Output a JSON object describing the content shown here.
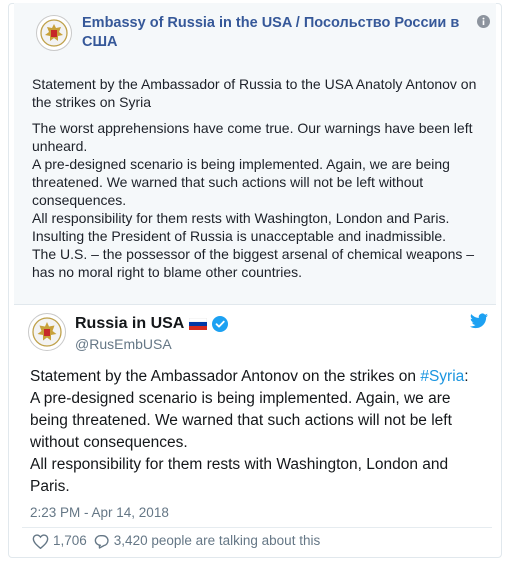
{
  "facebook_post": {
    "page_name": "Embassy of Russia in the USA / Посольство России в США",
    "heading": "Statement by the Ambassador of Russia to the USA Anatoly Antonov on the strikes on Syria",
    "lines": [
      "The worst apprehensions have come true. Our warnings have been left unheard.",
      "A pre-designed scenario is being implemented. Again, we are being threatened. We warned that such actions will not be left without consequences.",
      "All responsibility for them rests with Washington, London and Paris.",
      "Insulting the President of Russia is unacceptable and inadmissible.",
      "The U.S. – the possessor of the biggest arsenal of chemical weapons – has no moral right to blame other countries."
    ],
    "info_icon": "info-icon"
  },
  "tweet": {
    "display_name": "Russia in USA",
    "handle": "@RusEmbUSA",
    "text_before_hashtag": "Statement by the Ambassador Antonov on the strikes on ",
    "hashtag": "#Syria",
    "text_after_hashtag": ":",
    "lines": [
      "A pre-designed scenario is being implemented. Again, we are being threatened. We warned that such actions will not be left without consequences.",
      "All responsibility for them rests with Washington, London and Paris."
    ],
    "timestamp": "2:23 PM - Apr 14, 2018",
    "likes": "1,706",
    "talking": "3,420 people are talking about this",
    "icons": [
      "russia-flag-icon",
      "verified-badge-icon",
      "twitter-bird-icon",
      "heart-icon",
      "reply-icon"
    ]
  },
  "colors": {
    "facebook_link": "#365899",
    "twitter_blue": "#1da1f2",
    "hashtag": "#1b95e0",
    "muted": "#657786"
  }
}
